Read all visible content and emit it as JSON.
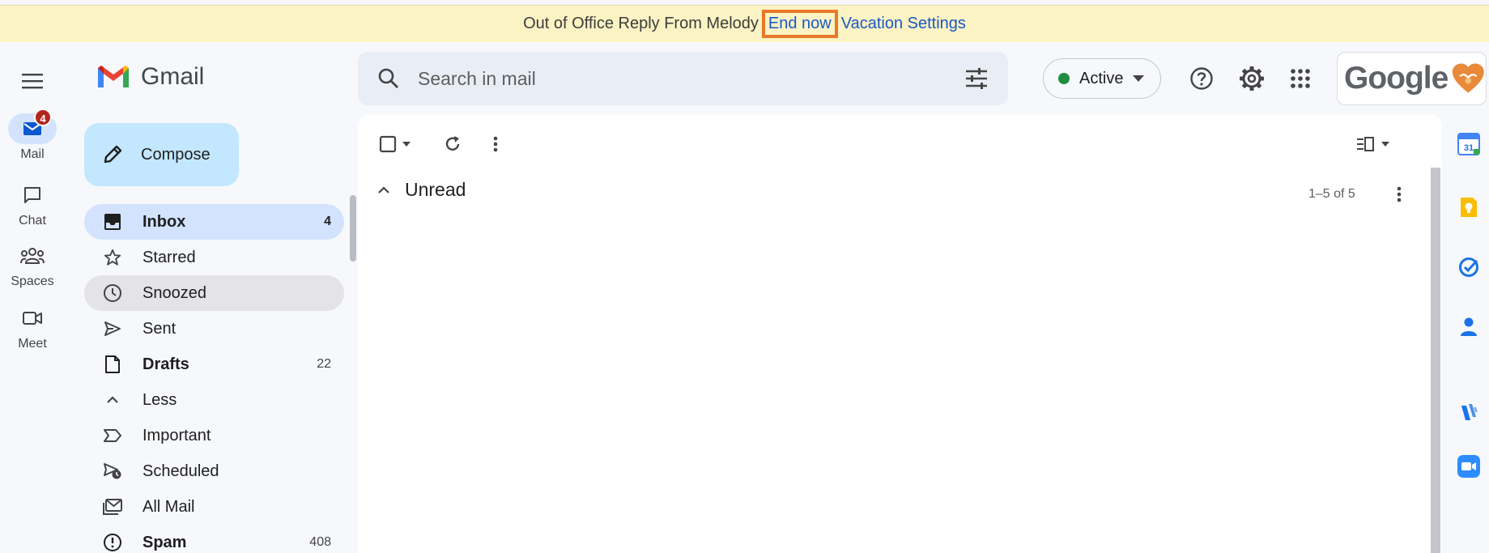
{
  "banner": {
    "message": "Out of Office Reply From Melody",
    "end_now": "End now",
    "vacation_settings": "Vacation Settings"
  },
  "rail": {
    "items": [
      {
        "label": "Mail",
        "badge": "4",
        "icon": "mail-icon"
      },
      {
        "label": "Chat",
        "icon": "chat-icon"
      },
      {
        "label": "Spaces",
        "icon": "spaces-icon"
      },
      {
        "label": "Meet",
        "icon": "meet-icon"
      }
    ]
  },
  "app": {
    "name": "Gmail"
  },
  "compose": {
    "label": "Compose"
  },
  "nav": {
    "items": [
      {
        "label": "Inbox",
        "count": "4",
        "icon": "inbox-icon"
      },
      {
        "label": "Starred",
        "count": "",
        "icon": "star-icon"
      },
      {
        "label": "Snoozed",
        "count": "",
        "icon": "clock-icon"
      },
      {
        "label": "Sent",
        "count": "",
        "icon": "send-icon"
      },
      {
        "label": "Drafts",
        "count": "22",
        "icon": "draft-icon"
      },
      {
        "label": "Less",
        "count": "",
        "icon": "chevron-up-icon"
      },
      {
        "label": "Important",
        "count": "",
        "icon": "important-icon"
      },
      {
        "label": "Scheduled",
        "count": "",
        "icon": "scheduled-icon"
      },
      {
        "label": "All Mail",
        "count": "",
        "icon": "all-mail-icon"
      },
      {
        "label": "Spam",
        "count": "408",
        "icon": "spam-icon"
      }
    ]
  },
  "search": {
    "placeholder": "Search in mail"
  },
  "status": {
    "label": "Active",
    "color": "#1e8e3e"
  },
  "account": {
    "logo_text": "Google"
  },
  "main": {
    "section_title": "Unread",
    "range": "1–5 of 5"
  },
  "side_apps": {
    "calendar_day": "31",
    "icons": [
      "calendar-icon",
      "keep-icon",
      "tasks-icon",
      "contacts-icon",
      "addon-icon",
      "zoom-icon"
    ]
  },
  "colors": {
    "banner_bg": "#fbf3c3",
    "highlight": "#e8792b",
    "link": "#1a58c6",
    "compose_bg": "#c2e7ff",
    "selected_bg": "#d3e3fd"
  }
}
